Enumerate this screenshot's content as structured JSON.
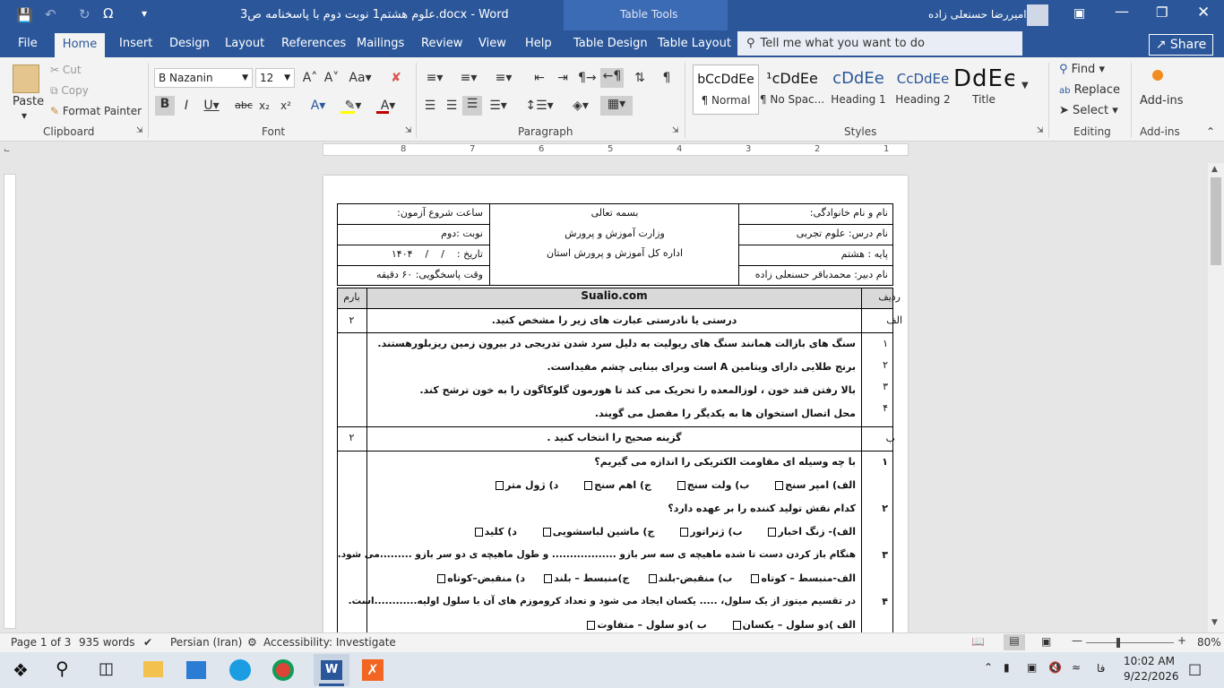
{
  "window": {
    "title": "علوم هشتم1 نوبت دوم با پاسخنامه ص3.docx - Word",
    "table_tools": "Table Tools",
    "user": "امیررضا حسنعلی زاده"
  },
  "tabs": [
    "File",
    "Home",
    "Insert",
    "Design",
    "Layout",
    "References",
    "Mailings",
    "Review",
    "View",
    "Help",
    "Table Design",
    "Table Layout"
  ],
  "tell_me": "Tell me what you want to do",
  "share": "Share",
  "clipboard": {
    "paste": "Paste",
    "cut": "Cut",
    "copy": "Copy",
    "format_painter": "Format Painter",
    "label": "Clipboard"
  },
  "font": {
    "name": "B Nazanin",
    "size": "12",
    "label": "Font"
  },
  "paragraph": {
    "label": "Paragraph"
  },
  "styles": {
    "label": "Styles",
    "items": [
      {
        "sample": "bCcDdEe",
        "name": "¶ Normal"
      },
      {
        "sample": "¹cDdEe",
        "name": "¶ No Spac..."
      },
      {
        "sample": "cDdEe",
        "name": "Heading 1"
      },
      {
        "sample": "CcDdEe",
        "name": "Heading 2"
      },
      {
        "sample": "DdEe",
        "name": "Title"
      }
    ]
  },
  "editing": {
    "find": "Find",
    "replace": "Replace",
    "select": "Select",
    "label": "Editing"
  },
  "addins": {
    "button": "Add-ins",
    "label": "Add-ins"
  },
  "ruler": {
    "numbers": [
      "8",
      "7",
      "6",
      "5",
      "4",
      "3",
      "2",
      "1",
      "1"
    ]
  },
  "doc": {
    "header": {
      "name": "نام و نام خانوادگی:",
      "bismillah": "بسمه تعالی",
      "start": "ساعت شروع آزمون:",
      "course": "نام درس: علوم تجربی",
      "ministry": "وزارت آموزش و پرورش",
      "turn": "نوبت :دوم",
      "grade": "پایه : هشتم",
      "office": "اداره کل آموزش و پرورش استان",
      "date": "تاریخ :    /    /    ۱۴۰۴",
      "teacher": "نام دبیر: محمدباقر حسنعلی زاده",
      "duration": "وقت پاسخگویی: ۶۰ دقیقه"
    },
    "col_row": "ردیف",
    "site": "Sualio.com",
    "col_score": "بارم",
    "sec_a": {
      "key": "الف",
      "title": "درستی یا نادرستی عبارت های زیر را مشخص کنید.",
      "score": "۲",
      "items": [
        {
          "n": "۱",
          "t": "سنگ های بازالت همانند سنگ های ریولیت به دلیل سرد شدن تدریجی در بیرون زمین ریزبلورهستند."
        },
        {
          "n": "۲",
          "t": "برنج طلایی دارای ویتامین A  است وبرای بینایی چشم مفیداست."
        },
        {
          "n": "۳",
          "t": "بالا رفتن قند خون ، لوزالمعده را تحریک می کند تا هورمون گلوکاگون را به خون ترشح کند."
        },
        {
          "n": "۴",
          "t": "محل اتصال استخوان ها به یکدیگر را مفصل می گویند."
        }
      ]
    },
    "sec_b": {
      "key": "ب",
      "title": "گزینه صحیح را انتخاب کنید .",
      "score": "۲",
      "items": [
        {
          "n": "۱",
          "q": "با چه وسیله ای مقاومت الکتریکی را اندازه می گیریم؟",
          "o": [
            "الف) امپر سنج",
            "ب) ولت سنج",
            "ج) اهم سنج",
            "د) ژول متر"
          ]
        },
        {
          "n": "۲",
          "q": "کدام نقش تولید کننده را بر عهده دارد؟",
          "o": [
            "الف)- زنگ اخبار",
            "ب) ژنراتور",
            "ج) ماشین لباسشویی",
            "د) کلید"
          ]
        },
        {
          "n": "۳",
          "q": "هنگام باز کردن دست تا شده ماهیچه ی سه سر بازو .................. و طول ماهیچه ی دو سر بازو .........می شود.",
          "o": [
            "الف-منبسط – کوتاه",
            "ب) منقبض-بلند",
            "ج)منبسط – بلند",
            "د) منقبض–کوتاه"
          ]
        },
        {
          "n": "۴",
          "q": "در تقسیم میتوز از یک سلول، ..... یکسان ایجاد می شود و تعداد کروموزم های آن با سلول اولیه............است.",
          "o": [
            "الف )دو سلول – یکسان",
            "ب )دو سلول – متفاوت"
          ]
        }
      ]
    }
  },
  "status": {
    "page": "Page 1 of 3",
    "words": "935 words",
    "language": "Persian (Iran)",
    "accessibility": "Accessibility: Investigate",
    "zoom": "80%"
  },
  "taskbar": {
    "time": "10:02 AM",
    "date": "9/22/2026",
    "lang": "فا"
  }
}
